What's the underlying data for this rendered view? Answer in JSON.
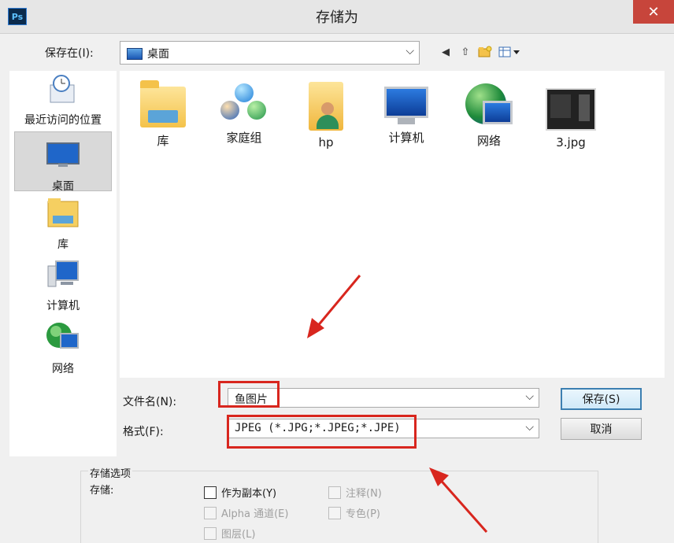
{
  "window": {
    "app_icon_text": "Ps",
    "title": "存储为",
    "close_label": "✕"
  },
  "location": {
    "label": "保存在(I):",
    "value": "桌面"
  },
  "places": [
    {
      "label": "最近访问的位置",
      "icon": "recent-places-icon"
    },
    {
      "label": "桌面",
      "icon": "desktop-icon",
      "selected": true
    },
    {
      "label": "库",
      "icon": "libraries-icon"
    },
    {
      "label": "计算机",
      "icon": "computer-icon"
    },
    {
      "label": "网络",
      "icon": "network-icon"
    }
  ],
  "files": [
    {
      "label": "库",
      "icon": "libraries-folder-icon"
    },
    {
      "label": "家庭组",
      "icon": "homegroup-icon"
    },
    {
      "label": "hp",
      "icon": "user-folder-icon"
    },
    {
      "label": "计算机",
      "icon": "computer-icon"
    },
    {
      "label": "网络",
      "icon": "network-globe-icon"
    },
    {
      "label": "3.jpg",
      "icon": "image-thumbnail-icon"
    }
  ],
  "filename": {
    "label": "文件名(N):",
    "value": "鱼图片"
  },
  "format": {
    "label": "格式(F):",
    "value": "JPEG (*.JPG;*.JPEG;*.JPE)"
  },
  "buttons": {
    "save": "保存(S)",
    "cancel": "取消"
  },
  "options": {
    "group_title": "存储选项",
    "store_label": "存储:",
    "as_copy": "作为副本(Y)",
    "notes": "注释(N)",
    "alpha": "Alpha 通道(E)",
    "spot": "专色(P)",
    "layers": "图层(L)"
  },
  "colors": {
    "annotation": "#d8261e",
    "close_button": "#c7453b"
  }
}
